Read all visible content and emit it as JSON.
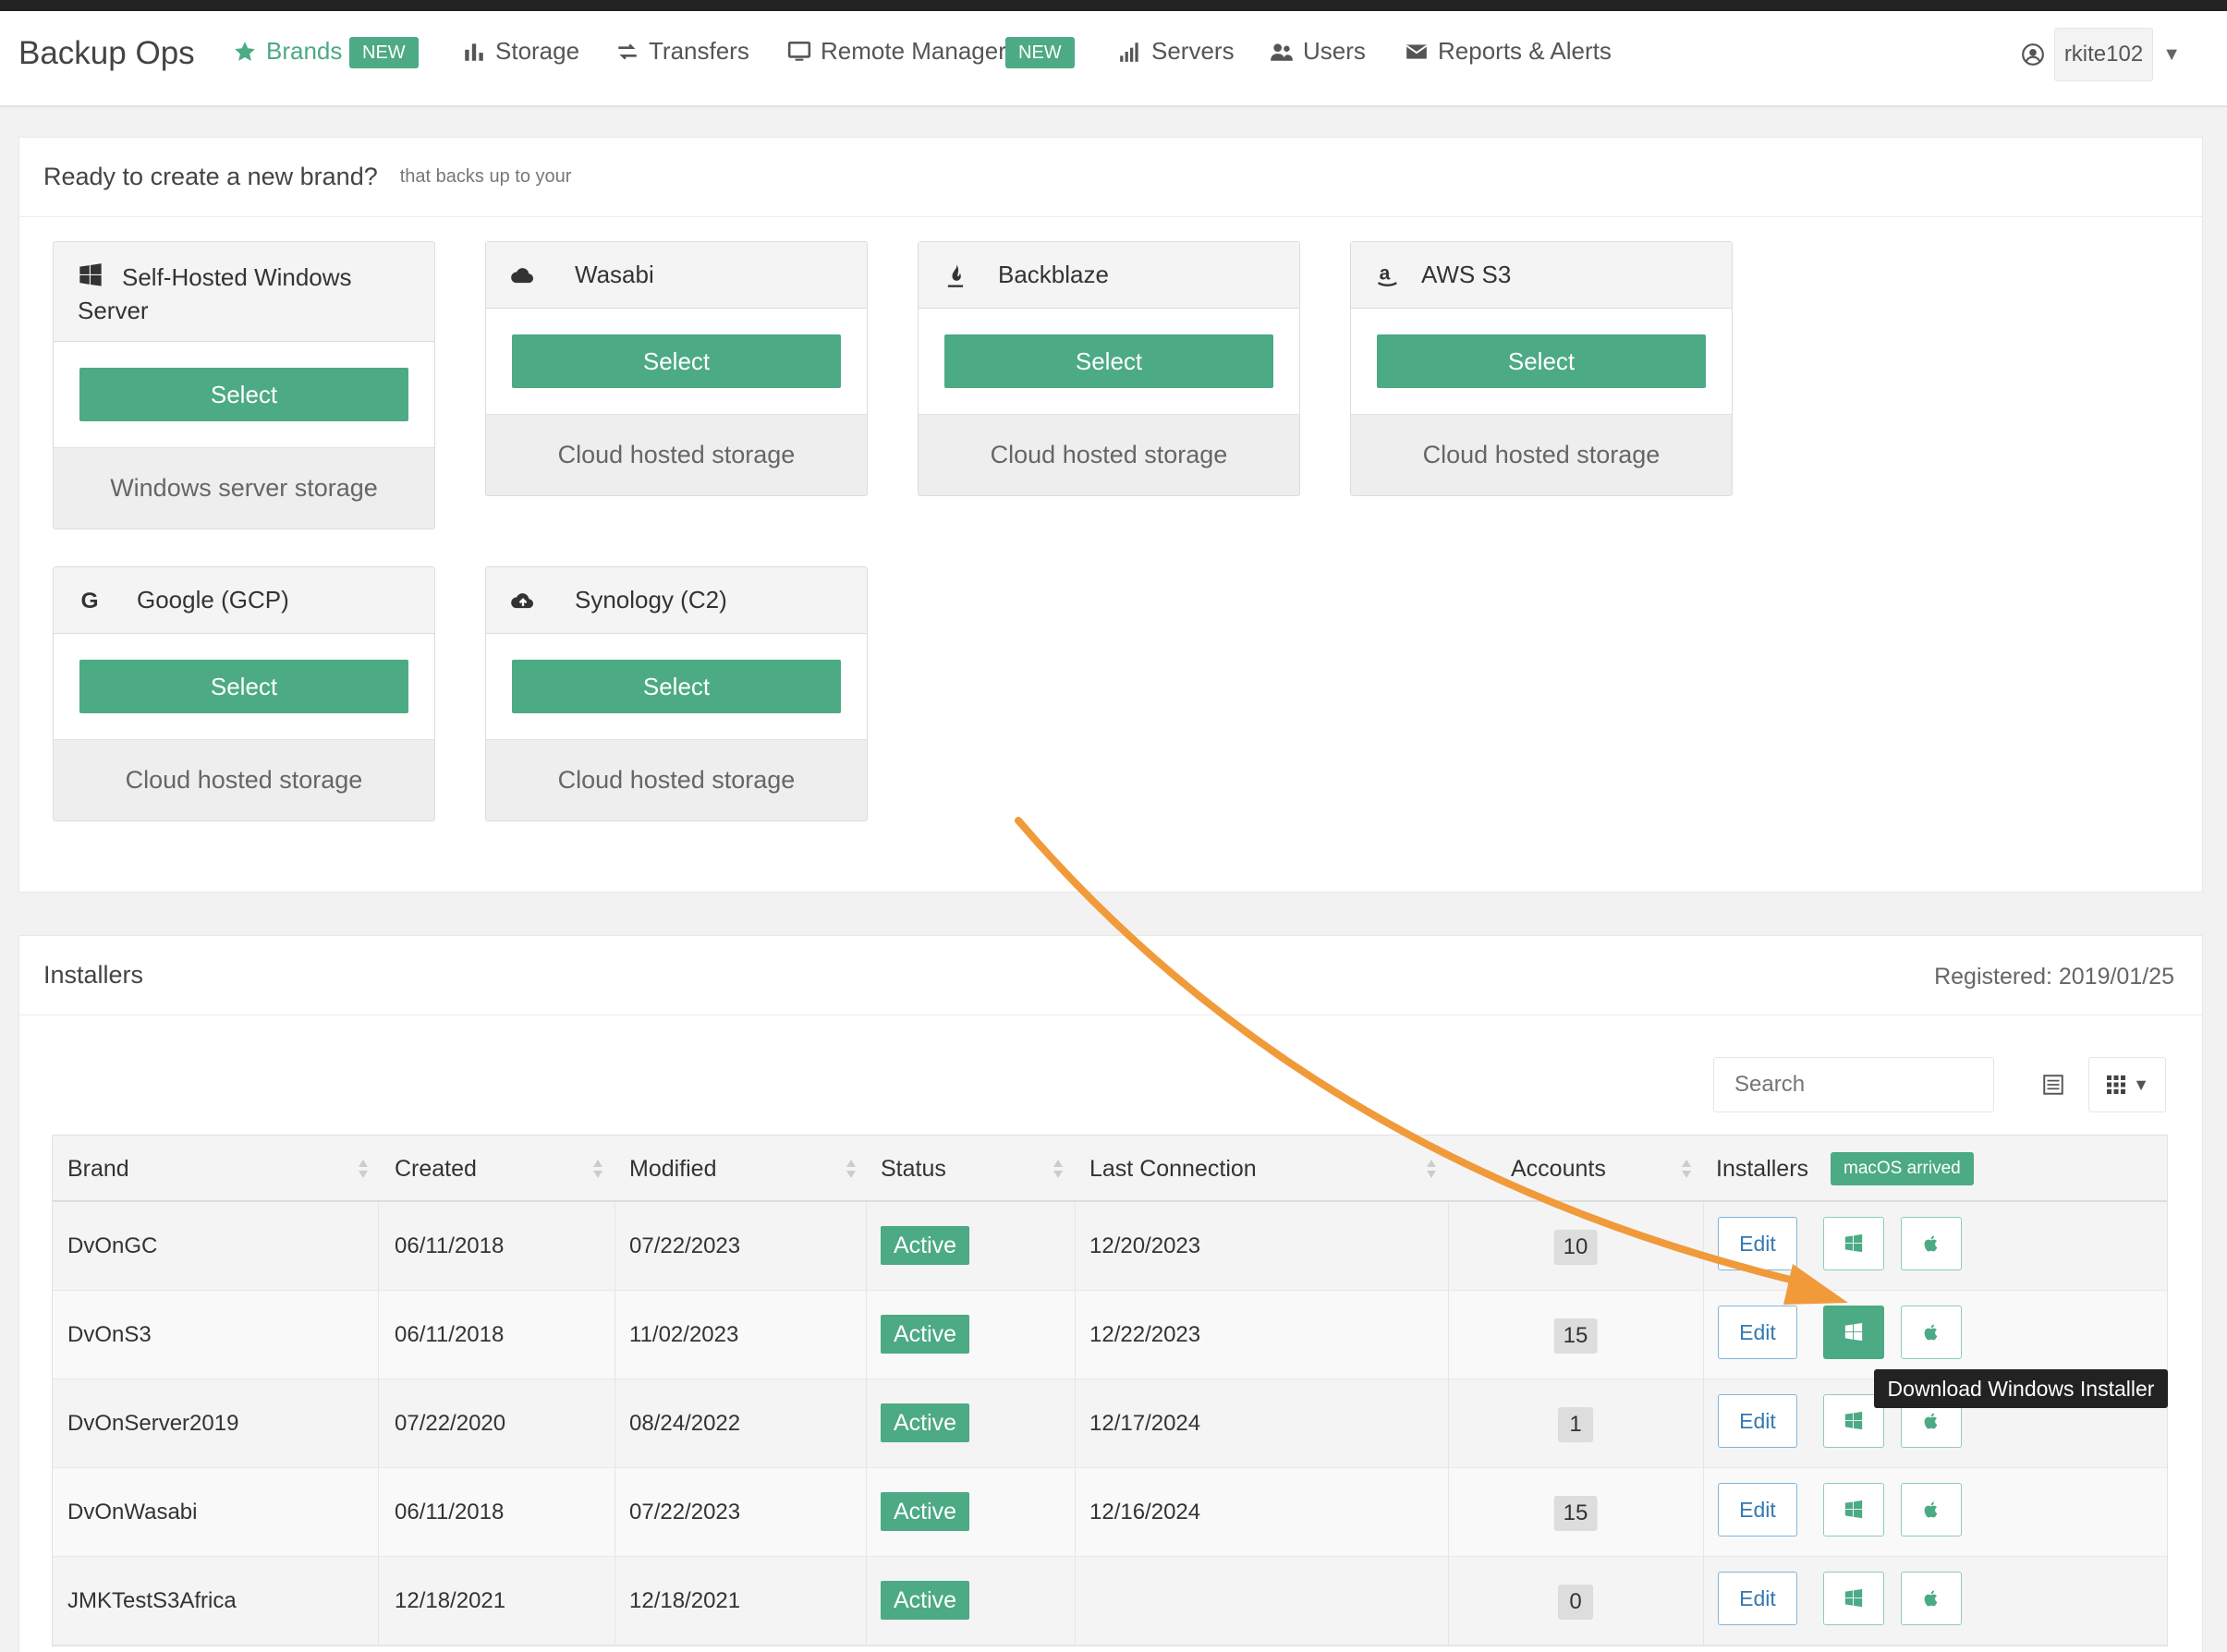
{
  "app": {
    "title": "Backup Ops"
  },
  "nav": {
    "items": [
      {
        "label": "Brands",
        "icon": "star-icon",
        "badge": "NEW"
      },
      {
        "label": "Storage",
        "icon": "bar-chart-icon"
      },
      {
        "label": "Transfers",
        "icon": "transfer-arrows-icon"
      },
      {
        "label": "Remote Manager",
        "icon": "monitor-icon",
        "badge": "NEW"
      },
      {
        "label": "Servers",
        "icon": "signal-bars-icon"
      },
      {
        "label": "Users",
        "icon": "users-icon"
      },
      {
        "label": "Reports & Alerts",
        "icon": "envelope-icon"
      }
    ],
    "user": "rkite102"
  },
  "brands_panel": {
    "title": "Ready to create a new brand?",
    "subtitle": "that backs up to your",
    "select_label": "Select",
    "cards": [
      {
        "name": "Self-Hosted Windows Server",
        "icon": "windows-icon",
        "desc": "Windows server storage"
      },
      {
        "name": "Wasabi",
        "icon": "cloud-icon",
        "desc": "Cloud hosted storage"
      },
      {
        "name": "Backblaze",
        "icon": "flame-icon",
        "desc": "Cloud hosted storage"
      },
      {
        "name": "AWS S3",
        "icon": "amazon-icon",
        "desc": "Cloud hosted storage"
      },
      {
        "name": "Google (GCP)",
        "icon": "google-icon",
        "desc": "Cloud hosted storage"
      },
      {
        "name": "Synology (C2)",
        "icon": "cloud-upload-icon",
        "desc": "Cloud hosted storage"
      }
    ]
  },
  "installers_panel": {
    "title": "Installers",
    "registered": "Registered: 2019/01/25",
    "search_placeholder": "Search",
    "mac_badge": "macOS arrived",
    "edit_label": "Edit",
    "tooltip": "Download Windows Installer",
    "columns": [
      "Brand",
      "Created",
      "Modified",
      "Status",
      "Last Connection",
      "Accounts",
      "Installers"
    ],
    "rows": [
      {
        "brand": "DvOnGC",
        "created": "06/11/2018",
        "modified": "07/22/2023",
        "status": "Active",
        "last_connection": "12/20/2023",
        "accounts": "10"
      },
      {
        "brand": "DvOnS3",
        "created": "06/11/2018",
        "modified": "11/02/2023",
        "status": "Active",
        "last_connection": "12/22/2023",
        "accounts": "15"
      },
      {
        "brand": "DvOnServer2019",
        "created": "07/22/2020",
        "modified": "08/24/2022",
        "status": "Active",
        "last_connection": "12/17/2024",
        "accounts": "1"
      },
      {
        "brand": "DvOnWasabi",
        "created": "06/11/2018",
        "modified": "07/22/2023",
        "status": "Active",
        "last_connection": "12/16/2024",
        "accounts": "15"
      },
      {
        "brand": "JMKTestS3Africa",
        "created": "12/18/2021",
        "modified": "12/18/2021",
        "status": "Active",
        "last_connection": "",
        "accounts": "0"
      }
    ]
  },
  "colors": {
    "accent": "#4caa84",
    "annotation_arrow": "#f09a3a"
  }
}
